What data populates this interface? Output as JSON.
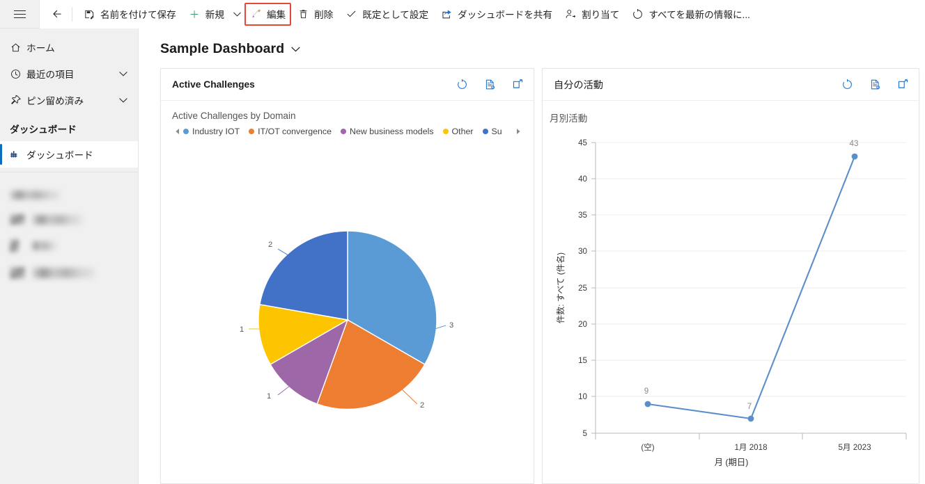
{
  "topbar": {
    "hamburger_label": "",
    "back_label": "",
    "commands": [
      {
        "label": "名前を付けて保存",
        "icon": "save-as-icon",
        "highlight": false,
        "chevron": false
      },
      {
        "label": "新規",
        "icon": "plus-icon",
        "highlight": false,
        "chevron": true
      },
      {
        "label": "編集",
        "icon": "pencil-icon",
        "highlight": true,
        "chevron": false
      },
      {
        "label": "削除",
        "icon": "trash-icon",
        "highlight": false,
        "chevron": false
      },
      {
        "label": "既定として設定",
        "icon": "check-icon",
        "highlight": false,
        "chevron": false
      },
      {
        "label": "ダッシュボードを共有",
        "icon": "share-icon",
        "highlight": false,
        "chevron": false
      },
      {
        "label": "割り当て",
        "icon": "assign-user-icon",
        "highlight": false,
        "chevron": false
      },
      {
        "label": "すべてを最新の情報に...",
        "icon": "refresh-icon",
        "highlight": false,
        "chevron": false
      }
    ]
  },
  "sidebar": {
    "items": [
      {
        "label": "ホーム",
        "icon": "home-icon",
        "chevron": false,
        "selected": false
      },
      {
        "label": "最近の項目",
        "icon": "clock-icon",
        "chevron": true,
        "selected": false
      },
      {
        "label": "ピン留め済み",
        "icon": "pin-icon",
        "chevron": true,
        "selected": false
      }
    ],
    "group_header": "ダッシュボード",
    "group_items": [
      {
        "label": "ダッシュボード",
        "icon": "dashboard-icon",
        "selected": true
      }
    ]
  },
  "page": {
    "title": "Sample Dashboard",
    "title_chevron": "chevron-down-icon"
  },
  "cards": [
    {
      "title": "Active Challenges",
      "actions": [
        "refresh-icon",
        "records-icon",
        "popout-icon"
      ],
      "chart_title": "Active Challenges by Domain"
    },
    {
      "title": "自分の活動",
      "actions": [
        "refresh-icon",
        "records-icon",
        "popout-icon"
      ],
      "chart_title": "月別活動"
    }
  ],
  "colors": {
    "accent": "#0f6cbd",
    "highlight_border": "#e8453c",
    "series_light_blue": "#5b9bd5",
    "series_orange": "#ed7d31",
    "series_purple": "#9e67a8",
    "series_yellow": "#fdc500",
    "series_dark_blue": "#4272c8",
    "line_blue": "#5b8fc9"
  },
  "chart_data": [
    {
      "type": "pie",
      "title": "Active Challenges by Domain",
      "categories": [
        "Industry IOT",
        "IT/OT convergence",
        "New business models",
        "Other",
        "Su"
      ],
      "values": [
        3,
        2,
        1,
        1,
        2
      ],
      "colors": [
        "#5b9bd5",
        "#ed7d31",
        "#9e67a8",
        "#fdc500",
        "#4272c8"
      ],
      "labels": [
        "3",
        "2",
        "1",
        "1",
        "2"
      ],
      "legend": [
        "Industry IOT",
        "IT/OT convergence",
        "New business models",
        "Other",
        "Su"
      ],
      "legend_position": "top",
      "legend_truncated": true,
      "legend_scroll_left": "◄",
      "legend_scroll_right": "►"
    },
    {
      "type": "line",
      "title": "月別活動",
      "xlabel": "月 (期日)",
      "ylabel": "件数: すべて (件名)",
      "categories": [
        "(空)",
        "1月 2018",
        "5月 2023"
      ],
      "values": [
        9,
        7,
        43
      ],
      "data_labels": [
        "9",
        "7",
        "43"
      ],
      "ylim": [
        5,
        45
      ],
      "yticks": [
        "5",
        "10",
        "15",
        "20",
        "25",
        "30",
        "35",
        "40",
        "45"
      ],
      "grid": true,
      "legend_position": "none",
      "color": "#5b8fc9"
    }
  ]
}
